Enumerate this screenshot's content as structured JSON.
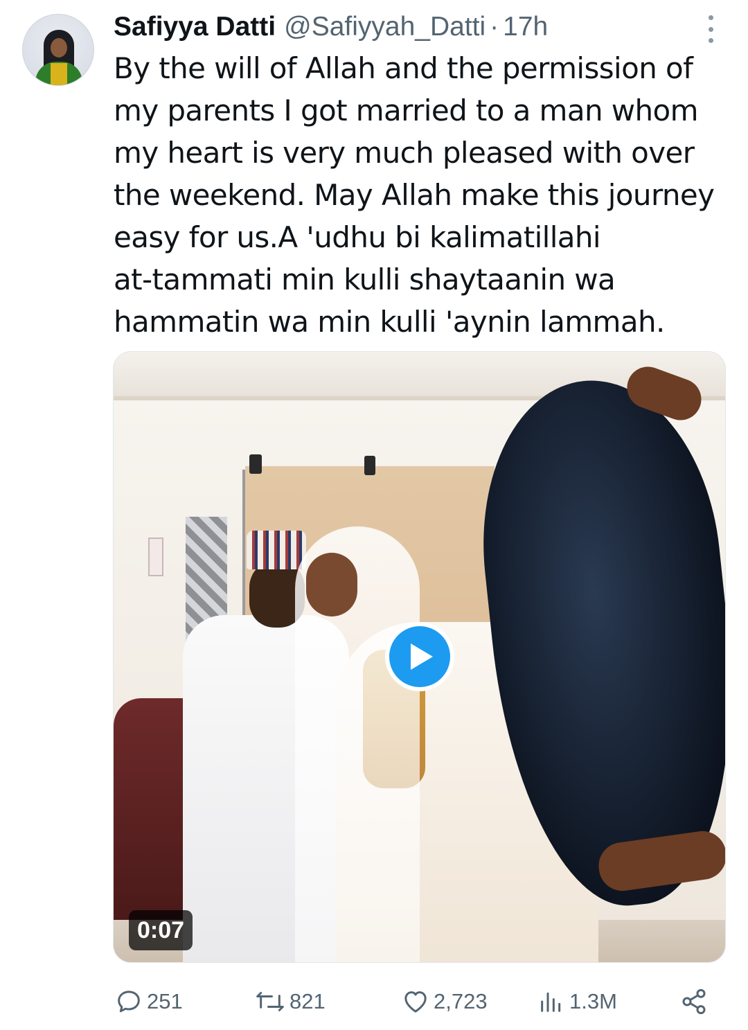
{
  "author": {
    "display_name": "Safiyya Datti",
    "handle": "@Safiyyah_Datti",
    "separator": "·",
    "time": "17h"
  },
  "tweet": {
    "text": "By the will of Allah and the permission of\nmy parents I got married to a man whom\nmy heart is very much pleased with over\nthe weekend. May Allah make this journey\neasy for us.A 'udhu bi kalimatillahi\nat-tammati min kulli shaytaanin wa\nhammatin wa min kulli 'aynin lammah."
  },
  "media": {
    "type": "video",
    "duration": "0:07",
    "play_icon": "play-icon"
  },
  "actions": {
    "replies": "251",
    "reposts": "821",
    "likes": "2,723",
    "views": "1.3M"
  },
  "icons": {
    "more": "more-vertical-icon",
    "reply": "reply-icon",
    "repost": "repost-icon",
    "like": "heart-icon",
    "views": "views-icon",
    "share": "share-icon"
  },
  "colors": {
    "accent": "#1d9bf0",
    "text_primary": "#0f1419",
    "text_secondary": "#536471"
  }
}
